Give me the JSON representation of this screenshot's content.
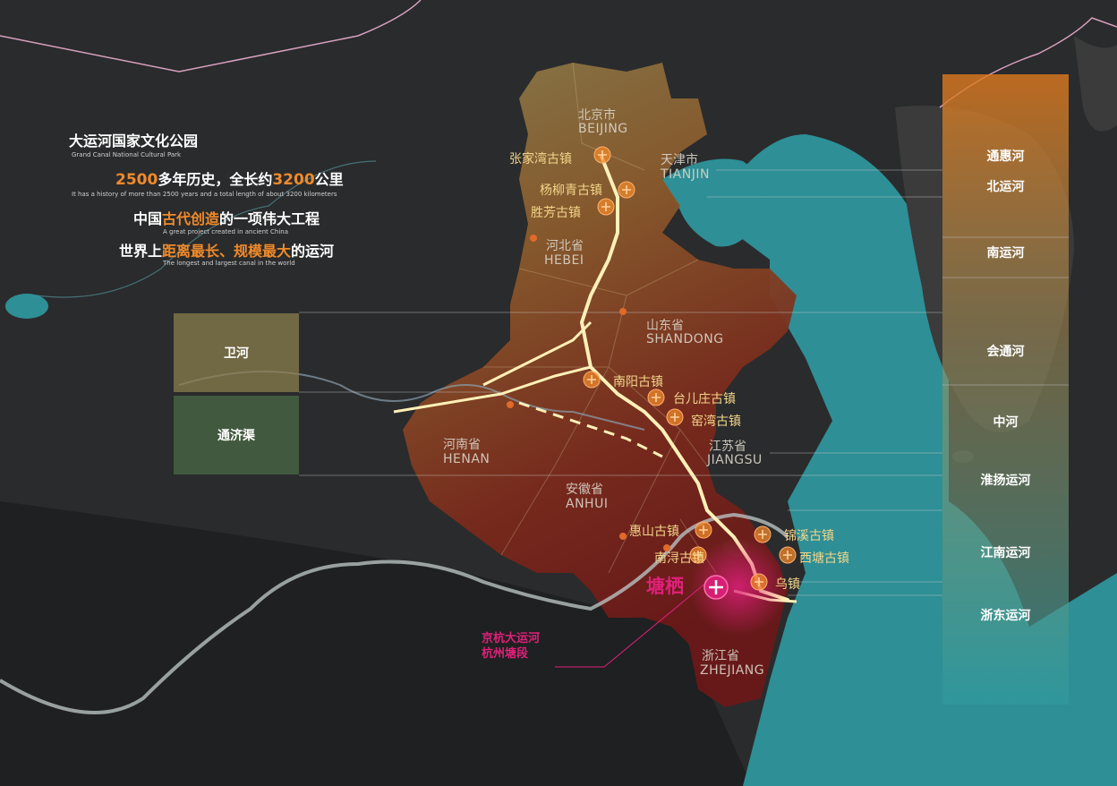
{
  "header": {
    "title_cn": "大运河国家文化公园",
    "title_en": "Grand Canal National Cultural Park",
    "line1": {
      "num1": "2500",
      "t1": "多年历史，全长约",
      "num2": "3200",
      "t2": "公里"
    },
    "line1_en": "It has a history of more than 2500 years and a total length of about 3200 kilometers",
    "line2": {
      "t1": "中国",
      "hl": "古代创造",
      "t2": "的一项伟大工程"
    },
    "line2_en": "A great project created in ancient China",
    "line3": {
      "t1": "世界上",
      "hl": "距离最长、规模最大",
      "t2": "的运河"
    },
    "line3_en": "The longest and largest canal in the world"
  },
  "provinces": [
    {
      "cn": "北京市",
      "en": "BEIJING"
    },
    {
      "cn": "天津市",
      "en": "TIANJIN"
    },
    {
      "cn": "河北省",
      "en": "HEBEI"
    },
    {
      "cn": "山东省",
      "en": "SHANDONG"
    },
    {
      "cn": "河南省",
      "en": "HENAN"
    },
    {
      "cn": "江苏省",
      "en": "JIANGSU"
    },
    {
      "cn": "安徽省",
      "en": "ANHUI"
    },
    {
      "cn": "浙江省",
      "en": "ZHEJIANG"
    }
  ],
  "towns": [
    "张家湾古镇",
    "杨柳青古镇",
    "胜芳古镇",
    "南阳古镇",
    "台儿庄古镇",
    "窑湾古镇",
    "惠山古镇",
    "南浔古镇",
    "锦溪古镇",
    "西塘古镇",
    "乌镇"
  ],
  "highlight": {
    "name": "塘栖",
    "callout_line1": "京杭大运河",
    "callout_line2": "杭州塘段"
  },
  "left_legend": [
    "卫河",
    "通济渠"
  ],
  "right_legend": [
    "通惠河",
    "北运河",
    "南运河",
    "会通河",
    "中河",
    "淮扬运河",
    "江南运河",
    "浙东运河"
  ],
  "colors": {
    "accent": "#f08a2a",
    "highlight": "#e0207a",
    "canal": "#fff0b8",
    "sea": "#2e8f96"
  }
}
